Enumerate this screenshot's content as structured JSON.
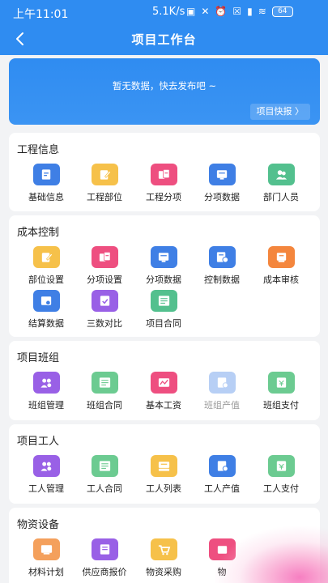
{
  "status": {
    "time": "上午11:01",
    "speed": "5.1K/s",
    "battery": "64"
  },
  "nav": {
    "title": "项目工作台"
  },
  "banner": {
    "empty_text": "暂无数据，快去发布吧 ~",
    "button_label": "项目快报 〉"
  },
  "sections": [
    {
      "title": "工程信息",
      "items": [
        {
          "label": "基础信息",
          "icon": "document-icon",
          "color": "#3f7fe5"
        },
        {
          "label": "工程部位",
          "icon": "edit-icon",
          "color": "#f6c14a"
        },
        {
          "label": "工程分项",
          "icon": "split-docs-icon",
          "color": "#ee4f80"
        },
        {
          "label": "分项数据",
          "icon": "data-docs-icon",
          "color": "#3f7fe5"
        },
        {
          "label": "部门人员",
          "icon": "people-icon",
          "color": "#53c08e"
        }
      ]
    },
    {
      "title": "成本控制",
      "items": [
        {
          "label": "部位设置",
          "icon": "edit-icon",
          "color": "#f6c14a"
        },
        {
          "label": "分项设置",
          "icon": "split-docs-icon",
          "color": "#ee4f80"
        },
        {
          "label": "分项数据",
          "icon": "data-docs-icon",
          "color": "#3f7fe5"
        },
        {
          "label": "控制数据",
          "icon": "control-icon",
          "color": "#3f7fe5"
        },
        {
          "label": "成本审核",
          "icon": "audit-icon",
          "color": "#f4863d"
        },
        {
          "label": "结算数据",
          "icon": "settle-icon",
          "color": "#3f7fe5"
        },
        {
          "label": "三数对比",
          "icon": "compare-icon",
          "color": "#9960e6"
        },
        {
          "label": "项目合同",
          "icon": "contract-icon",
          "color": "#53c08e"
        }
      ]
    },
    {
      "title": "项目班组",
      "items": [
        {
          "label": "班组管理",
          "icon": "team-icon",
          "color": "#9960e6"
        },
        {
          "label": "班组合同",
          "icon": "contract-icon",
          "color": "#6ccb91"
        },
        {
          "label": "基本工资",
          "icon": "wage-icon",
          "color": "#ee4f80"
        },
        {
          "label": "班组产值",
          "icon": "output-icon",
          "color": "#b7cff5",
          "dim": true
        },
        {
          "label": "班组支付",
          "icon": "payment-icon",
          "color": "#6ccb91"
        }
      ]
    },
    {
      "title": "项目工人",
      "items": [
        {
          "label": "工人管理",
          "icon": "team-icon",
          "color": "#9960e6"
        },
        {
          "label": "工人合同",
          "icon": "contract-icon",
          "color": "#6ccb91"
        },
        {
          "label": "工人列表",
          "icon": "list-icon",
          "color": "#f6c14a"
        },
        {
          "label": "工人产值",
          "icon": "output-icon",
          "color": "#3f7fe5"
        },
        {
          "label": "工人支付",
          "icon": "payment-icon",
          "color": "#6ccb91"
        }
      ]
    },
    {
      "title": "物资设备",
      "items": [
        {
          "label": "材料计划",
          "icon": "plan-icon",
          "color": "#f4a05c"
        },
        {
          "label": "供应商报价",
          "icon": "quote-icon",
          "color": "#9960e6"
        },
        {
          "label": "物资采购",
          "icon": "cart-icon",
          "color": "#f6c14a"
        },
        {
          "label": "物",
          "icon": "box-icon",
          "color": "#ee4f80"
        }
      ]
    }
  ]
}
